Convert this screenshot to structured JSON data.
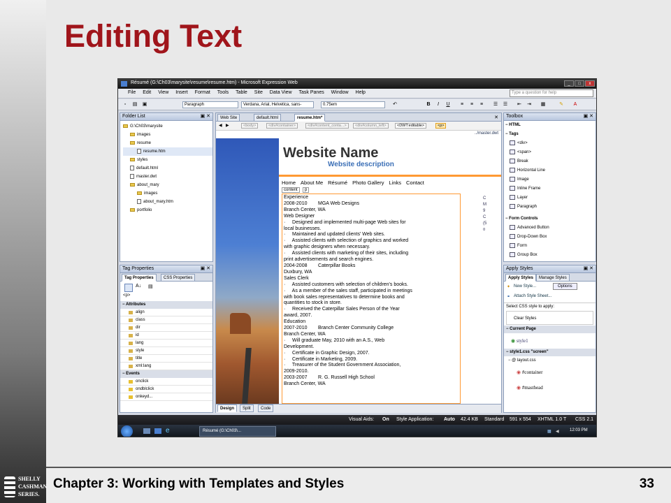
{
  "slide": {
    "title": "Editing Text",
    "footer": "Chapter 3: Working with Templates and Styles",
    "page_number": "33",
    "logo_lines": [
      "SHELLY",
      "CASHMAN",
      "SERIES."
    ]
  },
  "app": {
    "window_title": "Résumé (G:\\Ch03\\marysite\\resume\\resume.htm) - Microsoft Expression Web",
    "menu": [
      "File",
      "Edit",
      "View",
      "Insert",
      "Format",
      "Tools",
      "Table",
      "Site",
      "Data View",
      "Task Panes",
      "Window",
      "Help"
    ],
    "help_placeholder": "Type a question for help",
    "toolbar": {
      "style": "Paragraph",
      "font": "Verdana, Arial, Helvetica, sans-",
      "size": "0.75em"
    }
  },
  "folder_list": {
    "title": "Folder List",
    "items": [
      {
        "label": "G:\\Ch03\\marysite",
        "type": "folder"
      },
      {
        "label": "images",
        "type": "folder"
      },
      {
        "label": "resume",
        "type": "folder"
      },
      {
        "label": "resume.htm",
        "type": "file"
      },
      {
        "label": "styles",
        "type": "folder"
      },
      {
        "label": "default.html",
        "type": "file"
      },
      {
        "label": "master.dwt",
        "type": "file"
      },
      {
        "label": "about_mary",
        "type": "folder"
      },
      {
        "label": "images",
        "type": "folder"
      },
      {
        "label": "about_mary.htm",
        "type": "file"
      },
      {
        "label": "portfolio",
        "type": "folder"
      }
    ]
  },
  "tag_properties": {
    "title": "Tag Properties",
    "tabs": [
      "Tag Properties",
      "CSS Properties"
    ],
    "tag": "<p>",
    "attributes_header": "Attributes",
    "attributes": [
      "align",
      "class",
      "dir",
      "id",
      "lang",
      "style",
      "title",
      "xml:lang"
    ],
    "events_header": "Events",
    "events": [
      "onclick",
      "ondblclick",
      "onkeyd..."
    ]
  },
  "editor": {
    "tabs": [
      "Web Site",
      "default.html",
      "resume.htm*"
    ],
    "breadcrumb": [
      "<body>",
      "<div#container>",
      "<div#content_conta...>",
      "<div#column_left>",
      "<DWT:editable>",
      "<p>"
    ],
    "master_path": "../master.dwt",
    "site_name": "Website Name",
    "site_desc": "Website description",
    "nav": [
      "Home",
      "About Me",
      "Résumé",
      "Photo Gallery",
      "Links",
      "Contact"
    ],
    "region_label": "content",
    "region_tag": "p",
    "lines": [
      "Experience",
      "2008-2010        MGA Web Designs",
      "Branch Center, WA",
      "Web Designer",
      "·     Designed and implemented multi-page Web sites for",
      "local businesses.",
      "·     Maintained and updated clients' Web sites.",
      "·     Assisted clients with selection of graphics and worked",
      "with graphic designers when necessary.",
      "·     Assisted clients with marketing of their sites, including",
      "print advertisements and search engines.",
      "2004-2008        Caterpillar Books",
      "Duxbury, WA",
      "Sales Clerk",
      "·     Assisted customers with selection of children's books.",
      "·     As a member of the sales staff, participated in meetings",
      "with book sales representatives to determine books and",
      "quantities to stock in store.",
      "·     Received the Caterpillar Sales Person of the Year",
      "award, 2007.",
      "Education",
      "2007-2010        Branch Center Community College",
      "Branch Center, WA",
      "·     Will graduate May, 2010 with an A.S., Web",
      "Development.",
      "·     Certificate in Graphic Design, 2007.",
      "·     Certificate in Marketing, 2009.",
      "·     Treasurer of the Student Government Association,",
      "2009-2010.",
      "2003-2007        R. G. Russell High School",
      "Branch Center, WA"
    ],
    "side_letters": [
      "C",
      "M",
      "9",
      "C",
      "(5",
      "¤"
    ],
    "view_tabs": [
      "Design",
      "Split",
      "Code"
    ]
  },
  "toolbox": {
    "title": "Toolbox",
    "html_header": "HTML",
    "tags_header": "Tags",
    "tags": [
      "<div>",
      "<span>",
      "Break",
      "Horizontal Line",
      "Image",
      "Inline Frame",
      "Layer",
      "Paragraph"
    ],
    "form_header": "Form Controls",
    "form": [
      "Advanced Button",
      "Drop-Down Box",
      "Form",
      "Group Box"
    ]
  },
  "apply_styles": {
    "title": "Apply Styles",
    "tabs": [
      "Apply Styles",
      "Manage Styles"
    ],
    "new_style": "New Style...",
    "options": "Options",
    "attach": "Attach Style Sheet...",
    "select_label": "Select CSS style to apply:",
    "clear": "Clear Styles",
    "current_page": "Current Page",
    "style1": "style1",
    "css_header": "style1.css \"screen\"",
    "import": "@ layout.css",
    "rules": [
      "#container",
      "#masthead"
    ]
  },
  "statusbar": {
    "visual_aids_label": "Visual Aids:",
    "visual_aids": "On",
    "style_app_label": "Style Application:",
    "style_app": "Auto",
    "size": "42.4 KB",
    "mode": "Standard",
    "dims": "591 x 554",
    "doctype": "XHTML 1.0 T",
    "css": "CSS 2.1"
  },
  "taskbar": {
    "task": "Résumé (G:\\Ch03\\...",
    "clock": "12:03 PM"
  },
  "colors": {
    "title": "#a0151b",
    "site_name": "#333333",
    "site_desc": "#3b6fb6",
    "nav_bar": "#ff9933"
  }
}
